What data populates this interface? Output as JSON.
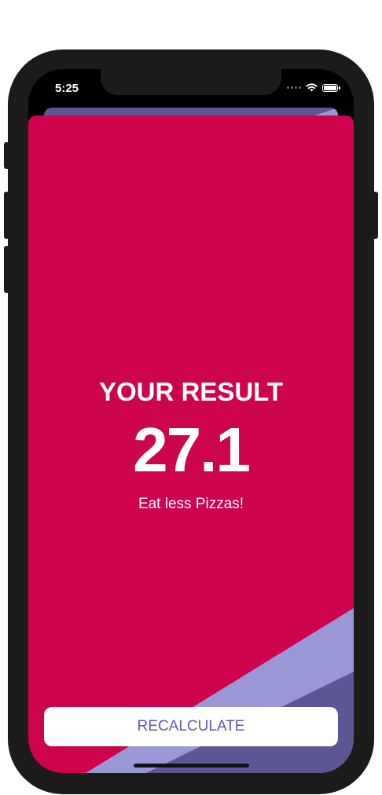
{
  "status_bar": {
    "time": "5:25"
  },
  "result": {
    "title": "YOUR RESULT",
    "value": "27.1",
    "advice": "Eat less Pizzas!"
  },
  "actions": {
    "recalculate_label": "RECALCULATE"
  },
  "colors": {
    "background": "#cd034d",
    "stripe_light": "#9a97d7",
    "stripe_dark": "#5c5794",
    "button_text": "#5f59b3"
  },
  "icons": {
    "signal": "cellular-signal-icon",
    "wifi": "wifi-icon",
    "battery": "battery-icon"
  }
}
